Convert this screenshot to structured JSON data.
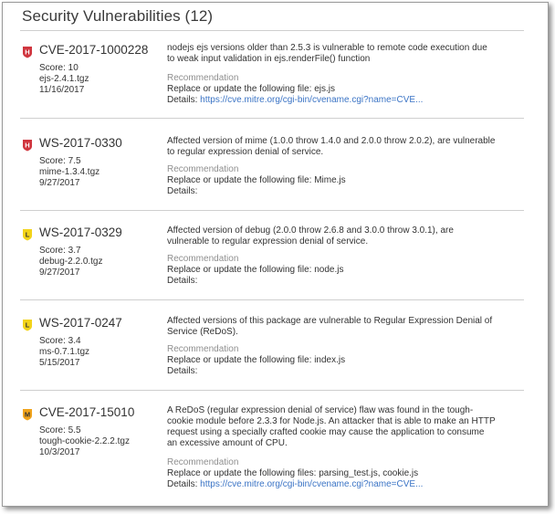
{
  "title": "Security Vulnerabilities (12)",
  "colors": {
    "high": "#d0363f",
    "low": "#f2d31a",
    "medium": "#f0a31c",
    "link": "#3b74c5",
    "muted": "#8f8f8f"
  },
  "recommendation_label": "Recommendation",
  "details_label": "Details:",
  "vulnerabilities": [
    {
      "severity": "H",
      "id": "CVE-2017-1000228",
      "score": "Score: 10",
      "package": "ejs-2.4.1.tgz",
      "date": "11/16/2017",
      "description": "nodejs ejs versions older than 2.5.3 is vulnerable to remote code execution due to weak input validation in ejs.renderFile() function",
      "recommendation": "Replace or update the following file: ejs.js",
      "details_link": "https://cve.mitre.org/cgi-bin/cvename.cgi?name=CVE..."
    },
    {
      "severity": "H",
      "id": "WS-2017-0330",
      "score": "Score: 7.5",
      "package": "mime-1.3.4.tgz",
      "date": "9/27/2017",
      "description": "Affected version of mime (1.0.0 throw 1.4.0 and 2.0.0 throw 2.0.2), are vulnerable to regular expression denial of service.",
      "recommendation": "Replace or update the following file: Mime.js",
      "details_link": ""
    },
    {
      "severity": "L",
      "id": "WS-2017-0329",
      "score": "Score: 3.7",
      "package": "debug-2.2.0.tgz",
      "date": "9/27/2017",
      "description": "Affected version of debug (2.0.0 throw 2.6.8 and 3.0.0 throw 3.0.1), are vulnerable to regular expression denial of service.",
      "recommendation": "Replace or update the following file: node.js",
      "details_link": ""
    },
    {
      "severity": "L",
      "id": "WS-2017-0247",
      "score": "Score: 3.4",
      "package": "ms-0.7.1.tgz",
      "date": "5/15/2017",
      "description": "Affected versions of this package are vulnerable to Regular Expression Denial of Service (ReDoS).",
      "recommendation": "Replace or update the following file: index.js",
      "details_link": ""
    },
    {
      "severity": "M",
      "id": "CVE-2017-15010",
      "score": "Score: 5.5",
      "package": "tough-cookie-2.2.2.tgz",
      "date": "10/3/2017",
      "description": "A ReDoS (regular expression denial of service) flaw was found in the tough-cookie module before 2.3.3 for Node.js. An attacker that is able to make an HTTP request using a specially crafted cookie may cause the application to consume an excessive amount of CPU.",
      "recommendation": "Replace or update the following files: parsing_test.js, cookie.js",
      "details_link": "https://cve.mitre.org/cgi-bin/cvename.cgi?name=CVE..."
    }
  ]
}
